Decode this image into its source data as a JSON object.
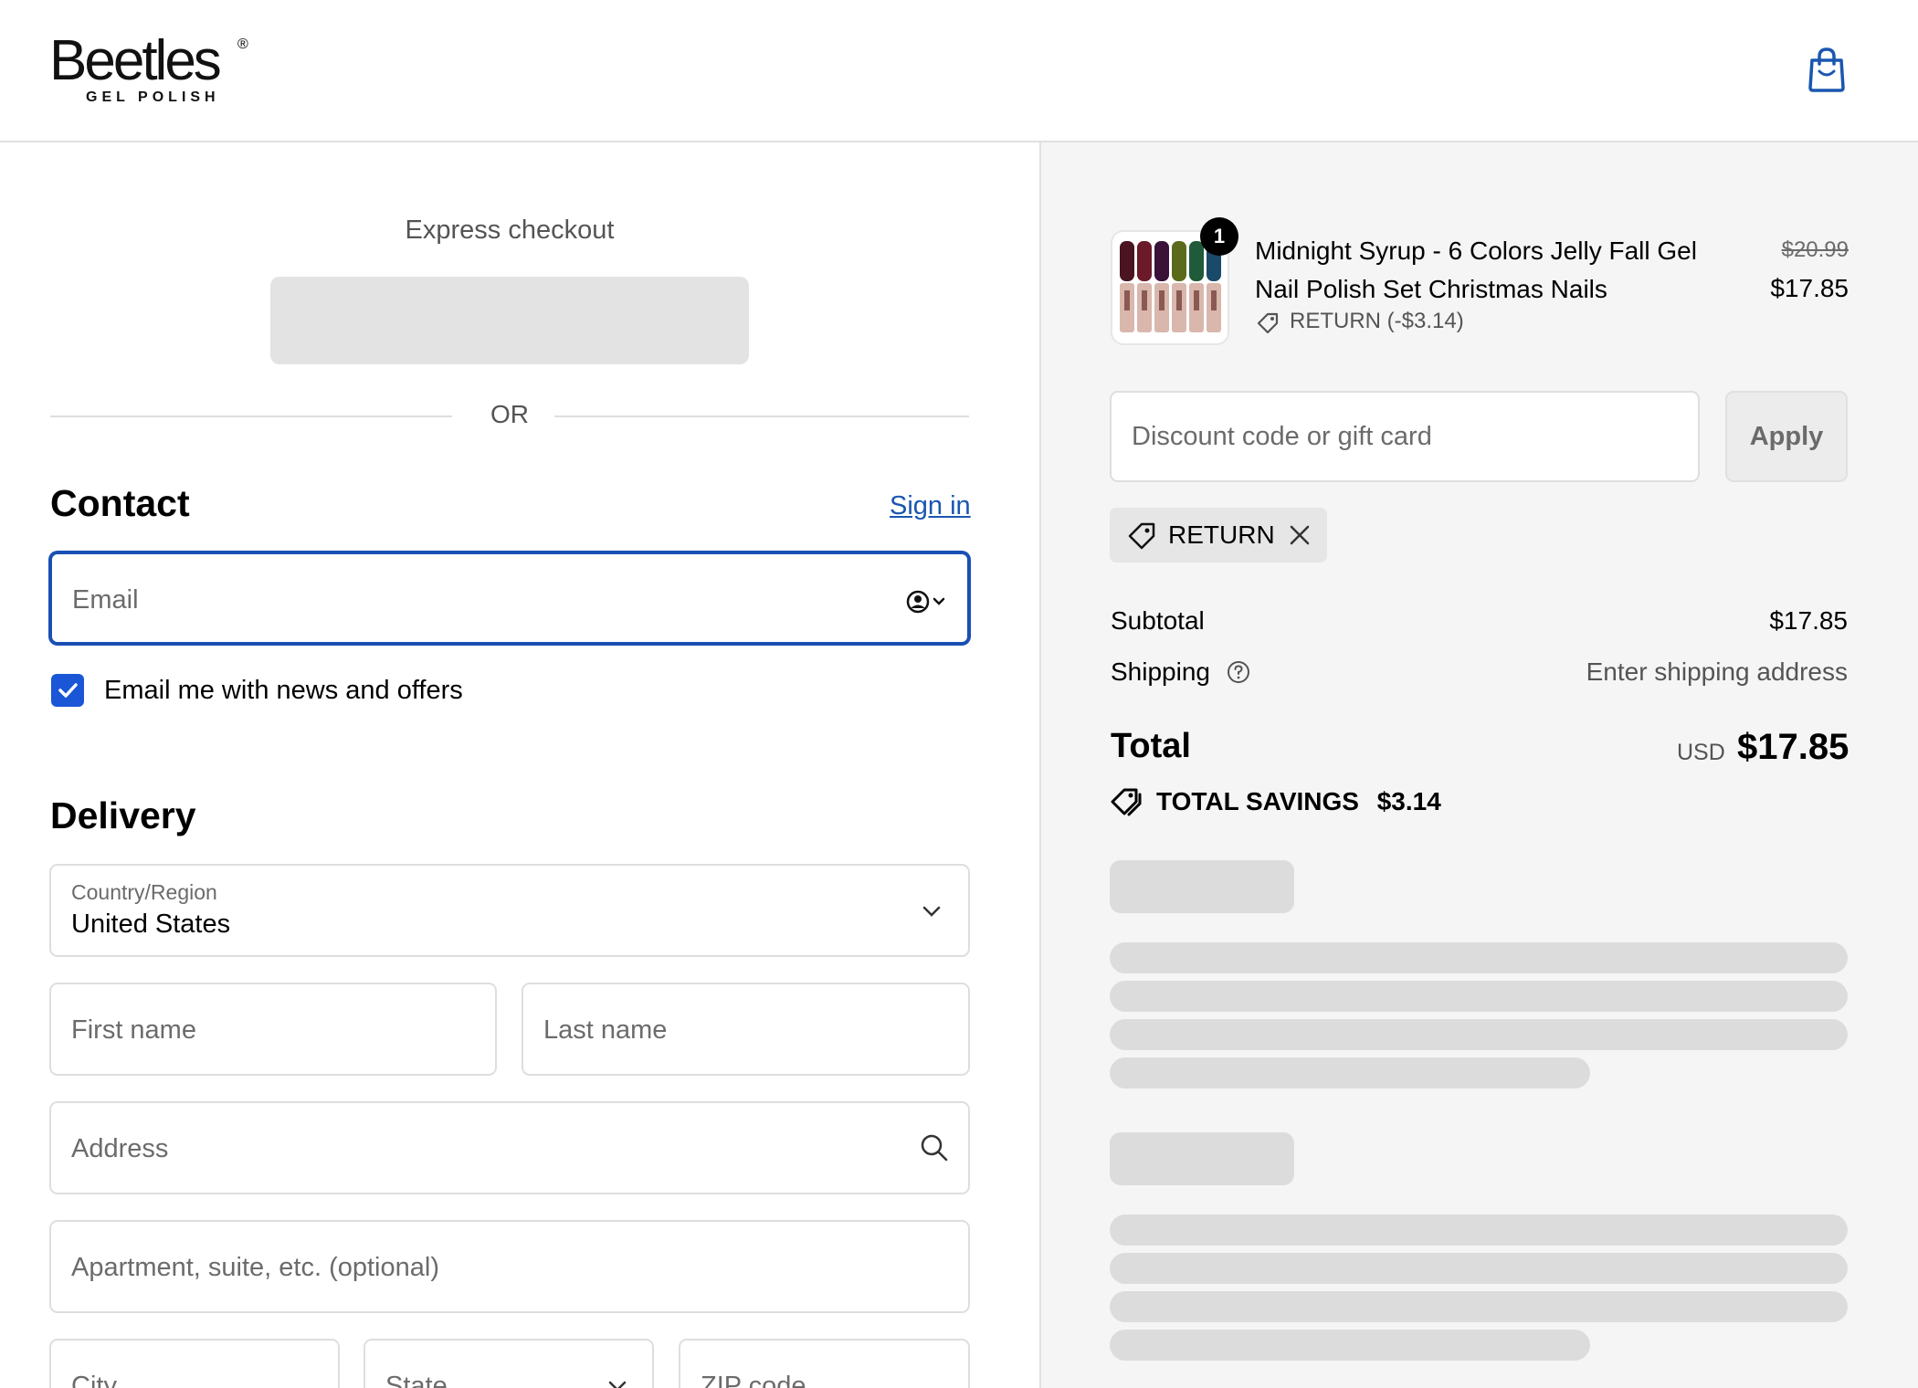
{
  "header": {
    "brand": "Beetles",
    "brand_mark": "®",
    "brand_sub": "GEL POLISH",
    "cart_icon": "shopping-bag-icon"
  },
  "express": {
    "title": "Express checkout",
    "divider": "OR"
  },
  "contact": {
    "title": "Contact",
    "sign_in": "Sign in",
    "email_placeholder": "Email",
    "newsletter_label": "Email me with news and offers",
    "newsletter_checked": true
  },
  "delivery": {
    "title": "Delivery",
    "country_label": "Country/Region",
    "country_value": "United States",
    "first_name": "First name",
    "last_name": "Last name",
    "address": "Address",
    "apartment": "Apartment, suite, etc. (optional)",
    "city": "City",
    "state": "State",
    "zip": "ZIP code"
  },
  "order": {
    "item": {
      "title": "Midnight Syrup - 6 Colors Jelly Fall Gel Nail Polish Set Christmas Nails",
      "quantity": "1",
      "discount": "RETURN (-$3.14)",
      "price_original": "$20.99",
      "price": "$17.85",
      "polish_colors": [
        "#4a1420",
        "#6b1a2a",
        "#3a1238",
        "#5a6a1a",
        "#1f5a3a",
        "#1a4a6a"
      ]
    },
    "discount_placeholder": "Discount code or gift card",
    "apply": "Apply",
    "applied_code": "RETURN",
    "subtotal_label": "Subtotal",
    "subtotal": "$17.85",
    "shipping_label": "Shipping",
    "shipping_value": "Enter shipping address",
    "total_label": "Total",
    "currency": "USD",
    "total": "$17.85",
    "savings_label": "TOTAL SAVINGS",
    "savings_value": "$3.14"
  },
  "colors": {
    "accent": "#1a4fb4",
    "link": "#1a56b0",
    "checkbox": "#1a56d6",
    "skeleton": "#dcdcdc"
  }
}
